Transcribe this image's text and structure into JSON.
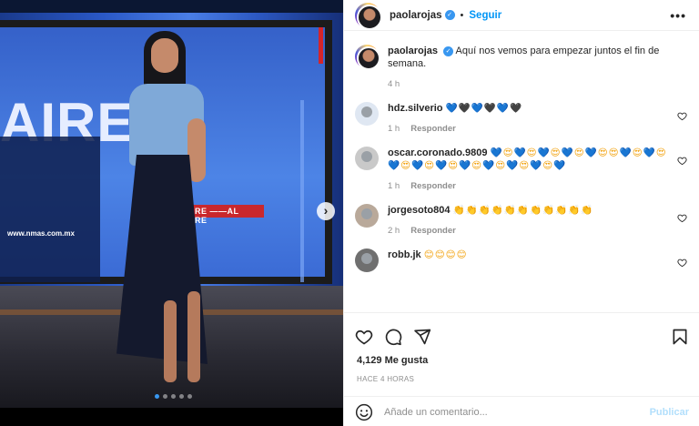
{
  "post": {
    "username": "paolarojas",
    "follow_label": "Seguir",
    "caption": "Aquí nos vemos para empezar juntos el fin de semana.",
    "caption_time": "4 h",
    "media": {
      "screen_text": "AIRE",
      "url_text": "www.nmas.com.mx",
      "banner_text": "AIRE ——AL AIRE",
      "carousel_dots": 5,
      "active_dot": 0
    }
  },
  "comments": [
    {
      "username": "hdz.silverio",
      "emojis": [
        {
          "c": "💙",
          "k": "blue"
        },
        {
          "c": "🖤",
          "k": "blk"
        },
        {
          "c": "💙",
          "k": "blue"
        },
        {
          "c": "🖤",
          "k": "blk"
        },
        {
          "c": "💙",
          "k": "blue"
        },
        {
          "c": "🖤",
          "k": "blk"
        }
      ],
      "time": "1 h",
      "reply_label": "Responder"
    },
    {
      "username": "oscar.coronado.9809",
      "emojis": [
        {
          "c": "💙",
          "k": "blue"
        },
        {
          "c": "😍",
          "k": "org"
        },
        {
          "c": "💙",
          "k": "blue"
        },
        {
          "c": "😍",
          "k": "org"
        },
        {
          "c": "💙",
          "k": "blue"
        },
        {
          "c": "😍",
          "k": "org"
        },
        {
          "c": "💙",
          "k": "blue"
        },
        {
          "c": "😍",
          "k": "org"
        },
        {
          "c": "💙",
          "k": "blue"
        },
        {
          "c": "😍",
          "k": "org"
        },
        {
          "c": "😍",
          "k": "org"
        },
        {
          "c": "💙",
          "k": "blue"
        },
        {
          "c": "😍",
          "k": "org"
        },
        {
          "c": "💙",
          "k": "blue"
        },
        {
          "c": "😍",
          "k": "org"
        },
        {
          "c": "💙",
          "k": "blue"
        },
        {
          "c": "😍",
          "k": "org"
        },
        {
          "c": "💙",
          "k": "blue"
        },
        {
          "c": "😍",
          "k": "org"
        },
        {
          "c": "💙",
          "k": "blue"
        },
        {
          "c": "😍",
          "k": "org"
        },
        {
          "c": "💙",
          "k": "blue"
        },
        {
          "c": "😍",
          "k": "org"
        },
        {
          "c": "💙",
          "k": "blue"
        },
        {
          "c": "😍",
          "k": "org"
        },
        {
          "c": "💙",
          "k": "blue"
        },
        {
          "c": "😍",
          "k": "org"
        },
        {
          "c": "💙",
          "k": "blue"
        },
        {
          "c": "😍",
          "k": "org"
        },
        {
          "c": "💙",
          "k": "blue"
        }
      ],
      "time": "1 h",
      "reply_label": "Responder"
    },
    {
      "username": "jorgesoto804",
      "emojis": [
        {
          "c": "👏",
          "k": "org"
        },
        {
          "c": "👏",
          "k": "org"
        },
        {
          "c": "👏",
          "k": "org"
        },
        {
          "c": "👏",
          "k": "org"
        },
        {
          "c": "👏",
          "k": "org"
        },
        {
          "c": "👏",
          "k": "org"
        },
        {
          "c": "👏",
          "k": "org"
        },
        {
          "c": "👏",
          "k": "org"
        },
        {
          "c": "👏",
          "k": "org"
        },
        {
          "c": "👏",
          "k": "org"
        },
        {
          "c": "👏",
          "k": "org"
        }
      ],
      "time": "2 h",
      "reply_label": "Responder"
    },
    {
      "username": "robb.jk",
      "emojis": [
        {
          "c": "😊",
          "k": "org"
        },
        {
          "c": "😊",
          "k": "org"
        },
        {
          "c": "😊",
          "k": "org"
        },
        {
          "c": "😊",
          "k": "org"
        }
      ],
      "time": "",
      "reply_label": ""
    }
  ],
  "footer": {
    "likes": "4,129 Me gusta",
    "posted_time": "HACE 4 HORAS",
    "comment_placeholder": "Añade un comentario...",
    "publish_label": "Publicar"
  },
  "icons": {
    "like": "heart-icon",
    "comment": "comment-icon",
    "share": "paper-plane-icon",
    "save": "bookmark-icon",
    "emoji": "smiley-icon",
    "more": "ellipsis-icon",
    "next": "chevron-right-icon"
  },
  "colors": {
    "link_blue": "#0095f6",
    "muted": "#8e8e8e",
    "publish_disabled": "#b2dffc",
    "text": "#262626"
  }
}
